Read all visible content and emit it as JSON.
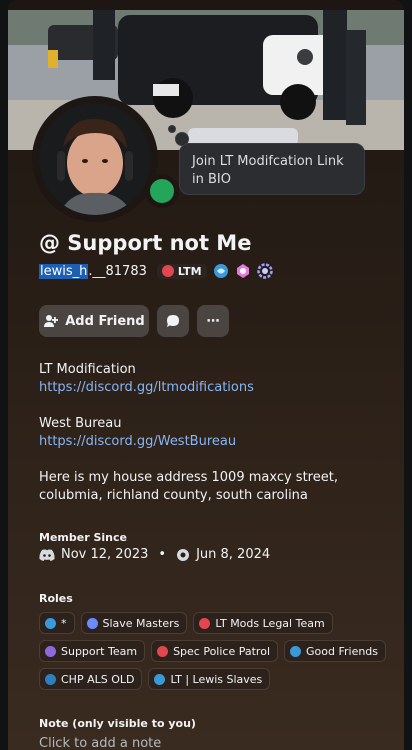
{
  "banner": {
    "alt": "police scene banner"
  },
  "status_bubble": {
    "text": "Join LT Modifcation Link in BIO"
  },
  "profile": {
    "display_name": "@ Support not Me",
    "username_selected": "lewis_h",
    "username_rest": ".__81783",
    "clan_tag": "LTM"
  },
  "actions": {
    "add_friend": "Add Friend",
    "more": "⋯"
  },
  "bio": [
    {
      "label": "LT Modification",
      "link": "https://discord.gg/ltmodifications"
    },
    {
      "label": "West Bureau",
      "link": "https://discord.gg/WestBureau"
    }
  ],
  "bio_text": "Here is my house address 1009 maxcy street, colubmia, richland county, south carolina",
  "member_since": {
    "header": "Member Since",
    "discord_date": "Nov 12, 2023",
    "separator": "•",
    "server_date": "Jun 8, 2024"
  },
  "roles": {
    "header": "Roles",
    "items": [
      {
        "name": "*",
        "color": "#3a9ad9"
      },
      {
        "name": "Slave Masters",
        "color": "#6b8cff"
      },
      {
        "name": "LT Mods Legal Team",
        "color": "#e0474f"
      },
      {
        "name": "Support Team",
        "color": "#8e6ad8"
      },
      {
        "name": "Spec Police Patrol",
        "color": "#e0474f"
      },
      {
        "name": "Good Friends",
        "color": "#3a9ad9"
      },
      {
        "name": "CHP ALS OLD",
        "color": "#2f7fbf"
      },
      {
        "name": "LT | Lewis Slaves",
        "color": "#3a9ad9"
      }
    ]
  },
  "note": {
    "header": "Note (only visible to you)",
    "placeholder": "Click to add a note"
  }
}
